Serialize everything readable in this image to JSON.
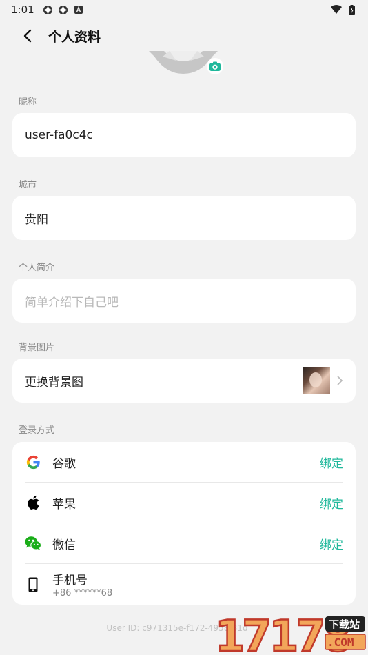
{
  "status_bar": {
    "time": "1:01"
  },
  "header": {
    "title": "个人资料"
  },
  "nickname": {
    "label": "昵称",
    "value": "user-fa0c4c"
  },
  "city": {
    "label": "城市",
    "value": "贵阳"
  },
  "bio": {
    "label": "个人简介",
    "placeholder": "简单介绍下自己吧"
  },
  "background": {
    "label": "背景图片",
    "action": "更换背景图"
  },
  "login": {
    "label": "登录方式",
    "google": {
      "name": "谷歌",
      "action": "绑定"
    },
    "apple": {
      "name": "苹果",
      "action": "绑定"
    },
    "wechat": {
      "name": "微信",
      "action": "绑定"
    },
    "phone": {
      "name": "手机号",
      "number": "+86 ******68"
    }
  },
  "footer": {
    "user_id": "User ID: c971315e-f172-4958-81d"
  },
  "watermark": {
    "text": "17178",
    "badge": "下载站"
  },
  "colors": {
    "accent": "#1fb89b",
    "background": "#f2f2f2",
    "card": "#ffffff"
  }
}
